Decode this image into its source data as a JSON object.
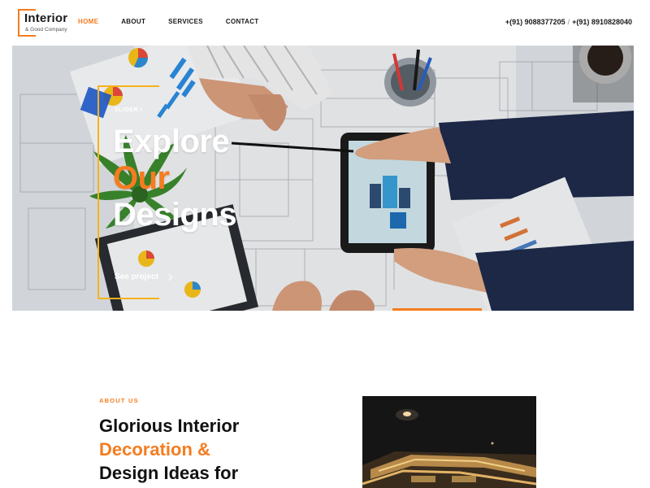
{
  "brand": {
    "name": "Interior",
    "tagline": "& Good Company",
    "accent_color": "#f57c1f",
    "frame_color": "#f7b21a"
  },
  "nav": {
    "items": [
      {
        "label": "HOME",
        "active": true
      },
      {
        "label": "ABOUT",
        "active": false
      },
      {
        "label": "SERVICES",
        "active": false
      },
      {
        "label": "CONTACT",
        "active": false
      }
    ]
  },
  "contact": {
    "phone_1": "+(91) 9088377205",
    "separator": "/",
    "phone_2": "+(91) 8910828040"
  },
  "hero": {
    "slider_label": "SLIDER I",
    "title_line_1": "Explore",
    "title_line_2": "Our",
    "title_line_3": "Designs",
    "cta_label": "See project",
    "cta_icon": "chevron-right-icon"
  },
  "about": {
    "section_label": "ABOUT US",
    "heading_line_1": "Glorious Interior",
    "heading_line_2": "Decoration &",
    "heading_line_3": "Design Ideas for"
  }
}
